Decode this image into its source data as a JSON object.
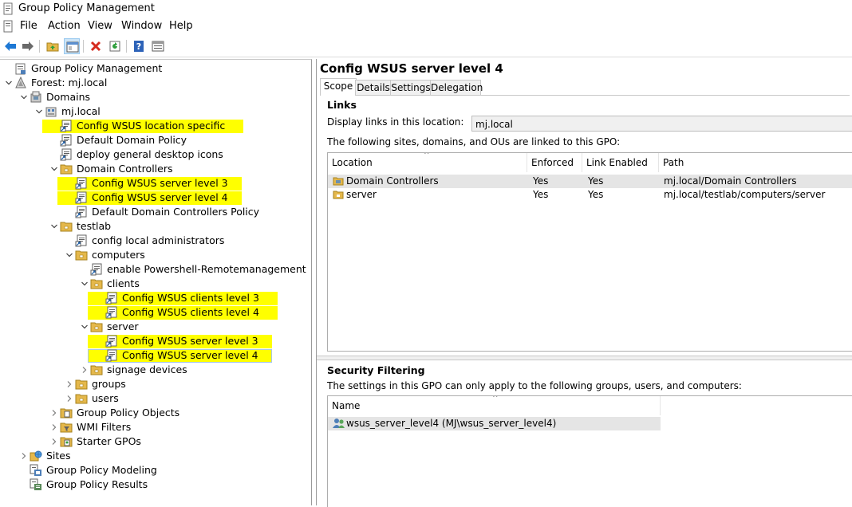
{
  "window": {
    "title": "Group Policy Management"
  },
  "menu": [
    "File",
    "Action",
    "View",
    "Window",
    "Help"
  ],
  "toolbar": {
    "buttons": [
      "back-arrow-icon",
      "forward-arrow-icon",
      "up-folder-icon",
      "show-hide-tree-icon",
      "delete-icon",
      "refresh-icon",
      "help-icon",
      "properties-icon"
    ],
    "colors": {
      "accent": "#1e78d4",
      "delete": "#d52b1e",
      "refresh": "#2e9e3c"
    }
  },
  "tree": {
    "highlight_color": "#ffff00",
    "nodes": [
      {
        "label": "Group Policy Management",
        "depth": 0,
        "icon": "gpm-root-icon",
        "chev": "",
        "hl": false
      },
      {
        "label": "Forest: mj.local",
        "depth": 0,
        "icon": "forest-icon",
        "chev": "down",
        "hl": false
      },
      {
        "label": "Domains",
        "depth": 1,
        "icon": "domains-icon",
        "chev": "down",
        "hl": false
      },
      {
        "label": "mj.local",
        "depth": 2,
        "icon": "domain-icon",
        "chev": "down",
        "hl": false
      },
      {
        "label": "Config WSUS location specific",
        "depth": 3,
        "icon": "gpo-link-icon",
        "chev": "",
        "hl": true
      },
      {
        "label": "Default Domain Policy",
        "depth": 3,
        "icon": "gpo-link-icon",
        "chev": "",
        "hl": false
      },
      {
        "label": "deploy general desktop icons",
        "depth": 3,
        "icon": "gpo-link-icon",
        "chev": "",
        "hl": false
      },
      {
        "label": "Domain Controllers",
        "depth": 3,
        "icon": "ou-folder-icon",
        "chev": "down",
        "hl": false
      },
      {
        "label": "Config WSUS server level 3",
        "depth": 4,
        "icon": "gpo-link-icon",
        "chev": "",
        "hl": true
      },
      {
        "label": "Config WSUS server level 4",
        "depth": 4,
        "icon": "gpo-link-icon",
        "chev": "",
        "hl": true
      },
      {
        "label": "Default Domain Controllers Policy",
        "depth": 4,
        "icon": "gpo-link-icon",
        "chev": "",
        "hl": false
      },
      {
        "label": "testlab",
        "depth": 3,
        "icon": "ou-folder-icon",
        "chev": "down",
        "hl": false
      },
      {
        "label": "config local administrators",
        "depth": 4,
        "icon": "gpo-link-icon",
        "chev": "",
        "hl": false
      },
      {
        "label": "computers",
        "depth": 4,
        "icon": "ou-folder-icon",
        "chev": "down",
        "hl": false
      },
      {
        "label": "enable Powershell-Remotemanagement",
        "depth": 5,
        "icon": "gpo-link-icon",
        "chev": "",
        "hl": false
      },
      {
        "label": "clients",
        "depth": 5,
        "icon": "ou-folder-icon",
        "chev": "down",
        "hl": false
      },
      {
        "label": "Config WSUS clients level 3",
        "depth": 6,
        "icon": "gpo-link-icon",
        "chev": "",
        "hl": true
      },
      {
        "label": "Config WSUS clients level 4",
        "depth": 6,
        "icon": "gpo-link-icon",
        "chev": "",
        "hl": true
      },
      {
        "label": "server",
        "depth": 5,
        "icon": "ou-folder-icon",
        "chev": "down",
        "hl": false
      },
      {
        "label": "Config WSUS server level 3",
        "depth": 6,
        "icon": "gpo-link-icon",
        "chev": "",
        "hl": true
      },
      {
        "label": "Config WSUS server level 4",
        "depth": 6,
        "icon": "gpo-link-icon",
        "chev": "",
        "hl": true,
        "selected": true
      },
      {
        "label": "signage devices",
        "depth": 5,
        "icon": "ou-folder-icon",
        "chev": "right",
        "hl": false
      },
      {
        "label": "groups",
        "depth": 4,
        "icon": "ou-folder-icon",
        "chev": "right",
        "hl": false
      },
      {
        "label": "users",
        "depth": 4,
        "icon": "ou-folder-icon",
        "chev": "right",
        "hl": false
      },
      {
        "label": "Group Policy Objects",
        "depth": 3,
        "icon": "gpo-container-icon",
        "chev": "right",
        "hl": false
      },
      {
        "label": "WMI Filters",
        "depth": 3,
        "icon": "wmi-filter-icon",
        "chev": "right",
        "hl": false
      },
      {
        "label": "Starter GPOs",
        "depth": 3,
        "icon": "starter-gpo-icon",
        "chev": "right",
        "hl": false
      },
      {
        "label": "Sites",
        "depth": 1,
        "icon": "sites-icon",
        "chev": "right",
        "hl": false
      },
      {
        "label": "Group Policy Modeling",
        "depth": 1,
        "icon": "modeling-icon",
        "chev": "",
        "hl": false
      },
      {
        "label": "Group Policy Results",
        "depth": 1,
        "icon": "results-icon",
        "chev": "",
        "hl": false
      }
    ]
  },
  "detail": {
    "title": "Config WSUS server level 4",
    "tabs": [
      "Scope",
      "Details",
      "Settings",
      "Delegation"
    ],
    "active_tab": 0,
    "links": {
      "heading": "Links",
      "display_label": "Display links in this location:",
      "display_value": "mj.local",
      "description": "The following sites, domains, and OUs are linked to this GPO:",
      "columns": [
        "Location",
        "Enforced",
        "Link Enabled",
        "Path"
      ],
      "rows": [
        {
          "location": "Domain Controllers",
          "icon": "domain-controllers-ou-icon",
          "enforced": "Yes",
          "enabled": "Yes",
          "path": "mj.local/Domain Controllers"
        },
        {
          "location": "server",
          "icon": "ou-folder-icon",
          "enforced": "Yes",
          "enabled": "Yes",
          "path": "mj.local/testlab/computers/server"
        }
      ]
    },
    "security": {
      "heading": "Security Filtering",
      "description": "The settings in this GPO can only apply to the following groups, users, and computers:",
      "columns": [
        "Name"
      ],
      "rows": [
        {
          "name": "wsus_server_level4 (MJ\\wsus_server_level4)",
          "icon": "group-icon"
        }
      ]
    }
  }
}
